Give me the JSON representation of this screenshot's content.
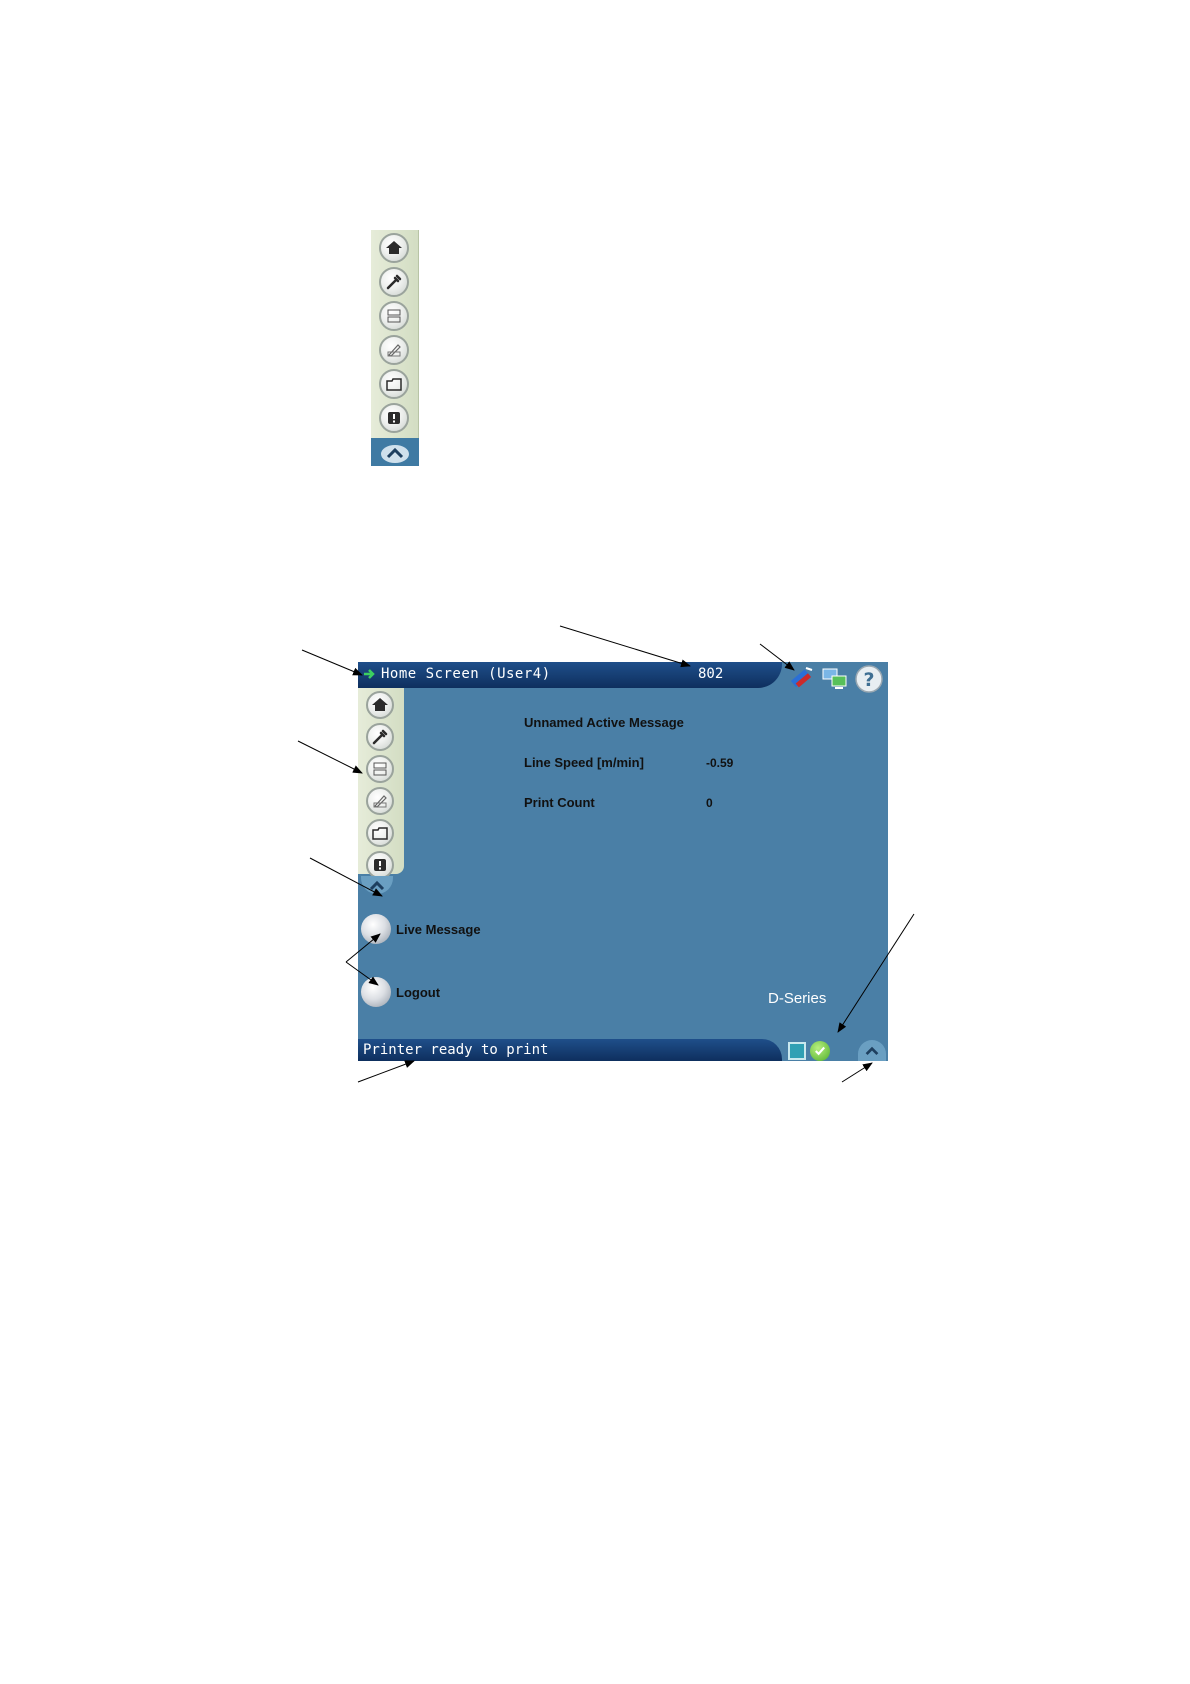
{
  "toolbar": {
    "items": [
      {
        "icon": "home-icon"
      },
      {
        "icon": "wrench-icon"
      },
      {
        "icon": "message-edit-icon"
      },
      {
        "icon": "message-create-icon"
      },
      {
        "icon": "file-manager-icon"
      },
      {
        "icon": "alert-icon"
      }
    ],
    "scroll_icon": "chevron-up-icon"
  },
  "header": {
    "title": "Home Screen (User4)",
    "count": "802",
    "icons": [
      "printhead-icon",
      "network-icon",
      "help-icon"
    ]
  },
  "info": {
    "message_name": "Unnamed Active Message",
    "line_speed_label": "Line Speed [m/min]",
    "line_speed_value": "-0.59",
    "print_count_label": "Print Count",
    "print_count_value": "0"
  },
  "actions": {
    "live_message": "Live Message",
    "logout": "Logout"
  },
  "brand": "D-Series",
  "status": {
    "text": "Printer ready to print"
  },
  "colors": {
    "screen_bg": "#4a7fa6",
    "bar_dark": "#0e2f5e",
    "rail_bg": "#dde5cf",
    "status_ok": "#4fae2a"
  }
}
